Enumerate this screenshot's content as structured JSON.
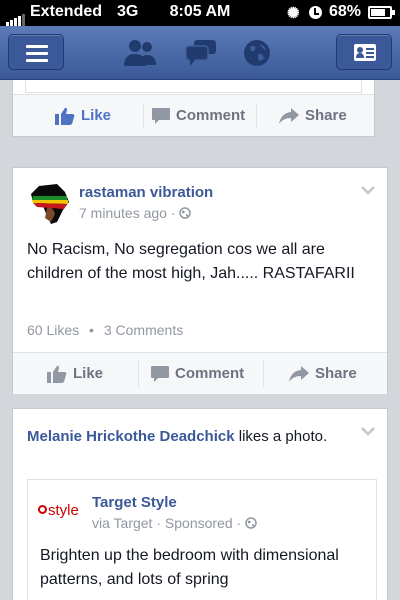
{
  "status": {
    "carrier": "Extended",
    "network": "3G",
    "time": "8:05 AM",
    "battery": "68%"
  },
  "nav": {
    "icons": [
      "menu-icon",
      "friend-requests-icon",
      "messages-icon",
      "notifications-globe-icon",
      "profile-card-icon"
    ]
  },
  "actions": {
    "like": "Like",
    "comment": "Comment",
    "share": "Share"
  },
  "post": {
    "author": "rastaman vibration",
    "time": "7 minutes ago",
    "sep": "·",
    "text": "No Racism, No segregation cos we all are children of the most high, Jah..... RASTAFARII",
    "likes": "60 Likes",
    "stats_sep": "•",
    "comments": "3 Comments"
  },
  "story": {
    "actor": "Melanie Hrickothe Deadchick",
    "verb": " likes a photo.",
    "ad": {
      "logo": "style",
      "page": "Target Style",
      "via": "via Target",
      "sep": "·",
      "sponsored": "Sponsored",
      "sep2": "·",
      "text": "Brighten up the bedroom with dimensional patterns, and lots of spring"
    }
  },
  "colors": {
    "brand": "#3b5998",
    "link_active": "#4f72c4",
    "muted": "#9197a3"
  }
}
